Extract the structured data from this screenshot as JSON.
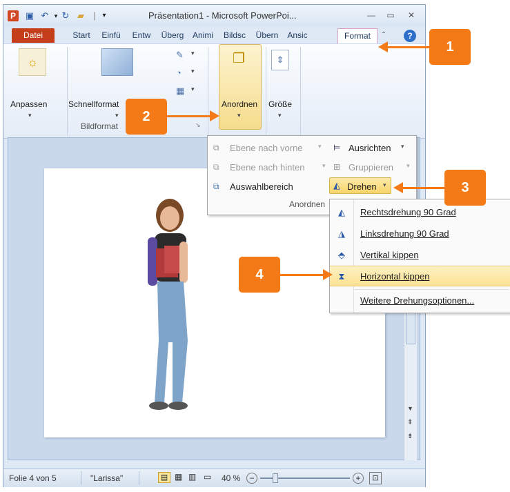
{
  "window": {
    "title": "Präsentation1 - Microsoft PowerPoi...",
    "app_icon": "P",
    "minimize": "—",
    "maximize": "▭",
    "close": "✕"
  },
  "tabs": [
    "Datei",
    "Start",
    "Einfü",
    "Entw",
    "Überg",
    "Animi",
    "Bildsc",
    "Übern",
    "Ansic",
    "Format"
  ],
  "ribbon": {
    "adjust_label": "Anpassen",
    "quick_styles_label": "Schnellformat",
    "picture_format_group": "Bildformat",
    "arrange_label": "Anordnen",
    "size_label": "Größe"
  },
  "arrange_menu": {
    "bring_forward": "Ebene nach vorne",
    "send_backward": "Ebene nach hinten",
    "selection_pane": "Auswahlbereich",
    "align": "Ausrichten",
    "group": "Gruppieren",
    "rotate": "Drehen",
    "group_label": "Anordnen"
  },
  "rotate_menu": {
    "items": [
      "Rechtsdrehung 90 Grad",
      "Linksdrehung 90 Grad",
      "Vertikal kippen",
      "Horizontal kippen",
      "Weitere Drehungsoptionen..."
    ]
  },
  "status": {
    "slide_counter": "Folie 4 von 5",
    "theme": "\"Larissa\"",
    "zoom": "40 %",
    "zoom_level": 0.4
  },
  "callouts": [
    "1",
    "2",
    "3",
    "4"
  ],
  "colors": {
    "callout": "#f37a17",
    "file_tab": "#c43e1c",
    "highlight": "#fbe79b"
  }
}
